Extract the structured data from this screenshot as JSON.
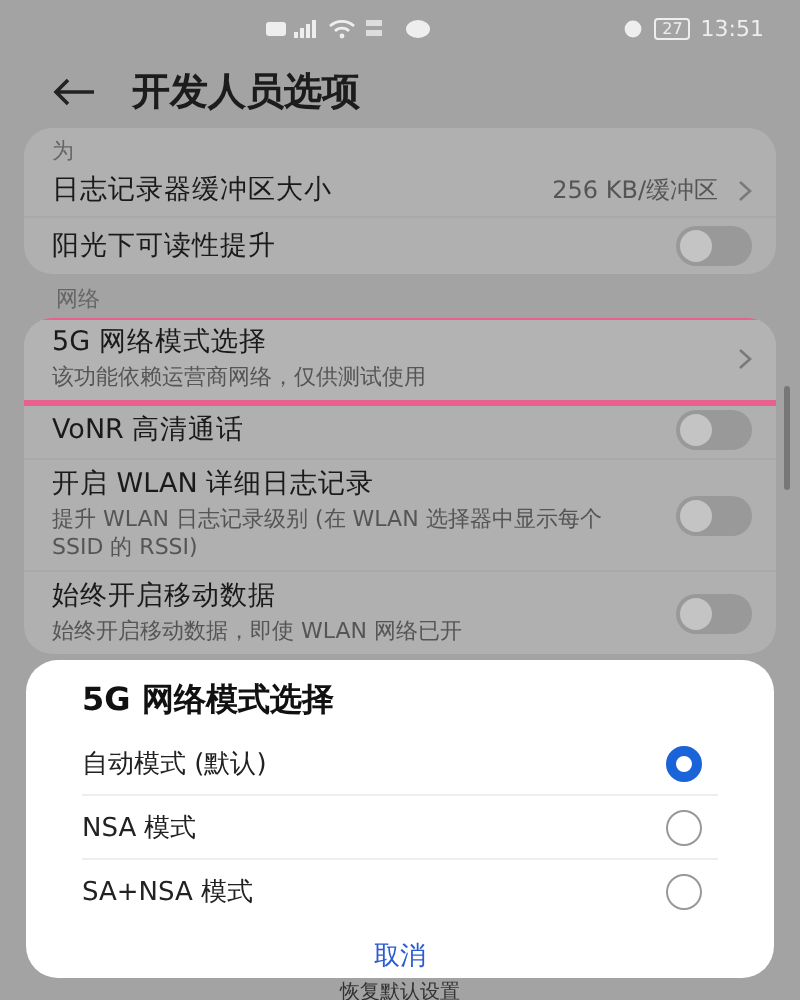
{
  "status_bar": {
    "time": "13:51",
    "battery": "27"
  },
  "header": {
    "title": "开发人员选项"
  },
  "sections": [
    {
      "label": "为",
      "rows": [
        {
          "kind": "value",
          "title": "日志记录器缓冲区大小",
          "value": "256 KB/缓冲区"
        },
        {
          "kind": "toggle",
          "title": "阳光下可读性提升",
          "on": false
        }
      ]
    },
    {
      "label": "网络",
      "rows": [
        {
          "kind": "link",
          "title": "5G 网络模式选择",
          "subtitle": "该功能依赖运营商网络，仅供测试使用",
          "highlighted": true
        },
        {
          "kind": "toggle",
          "title": "VoNR 高清通话",
          "on": false
        },
        {
          "kind": "toggle",
          "title": "开启 WLAN 详细日志记录",
          "subtitle": "提升 WLAN 日志记录级别 (在 WLAN 选择器中显示每个 SSID 的 RSSI)",
          "on": false
        },
        {
          "kind": "toggle",
          "title": "始终开启移动数据",
          "subtitle": "始终开启移动数据，即使 WLAN 网络已开",
          "on": false
        }
      ]
    }
  ],
  "footer": {
    "label": "恢复默认设置"
  },
  "dialog": {
    "title": "5G 网络模式选择",
    "options": [
      {
        "label": "自动模式 (默认)",
        "selected": true
      },
      {
        "label": "NSA 模式",
        "selected": false
      },
      {
        "label": "SA+NSA 模式",
        "selected": false
      }
    ],
    "cancel": "取消"
  }
}
